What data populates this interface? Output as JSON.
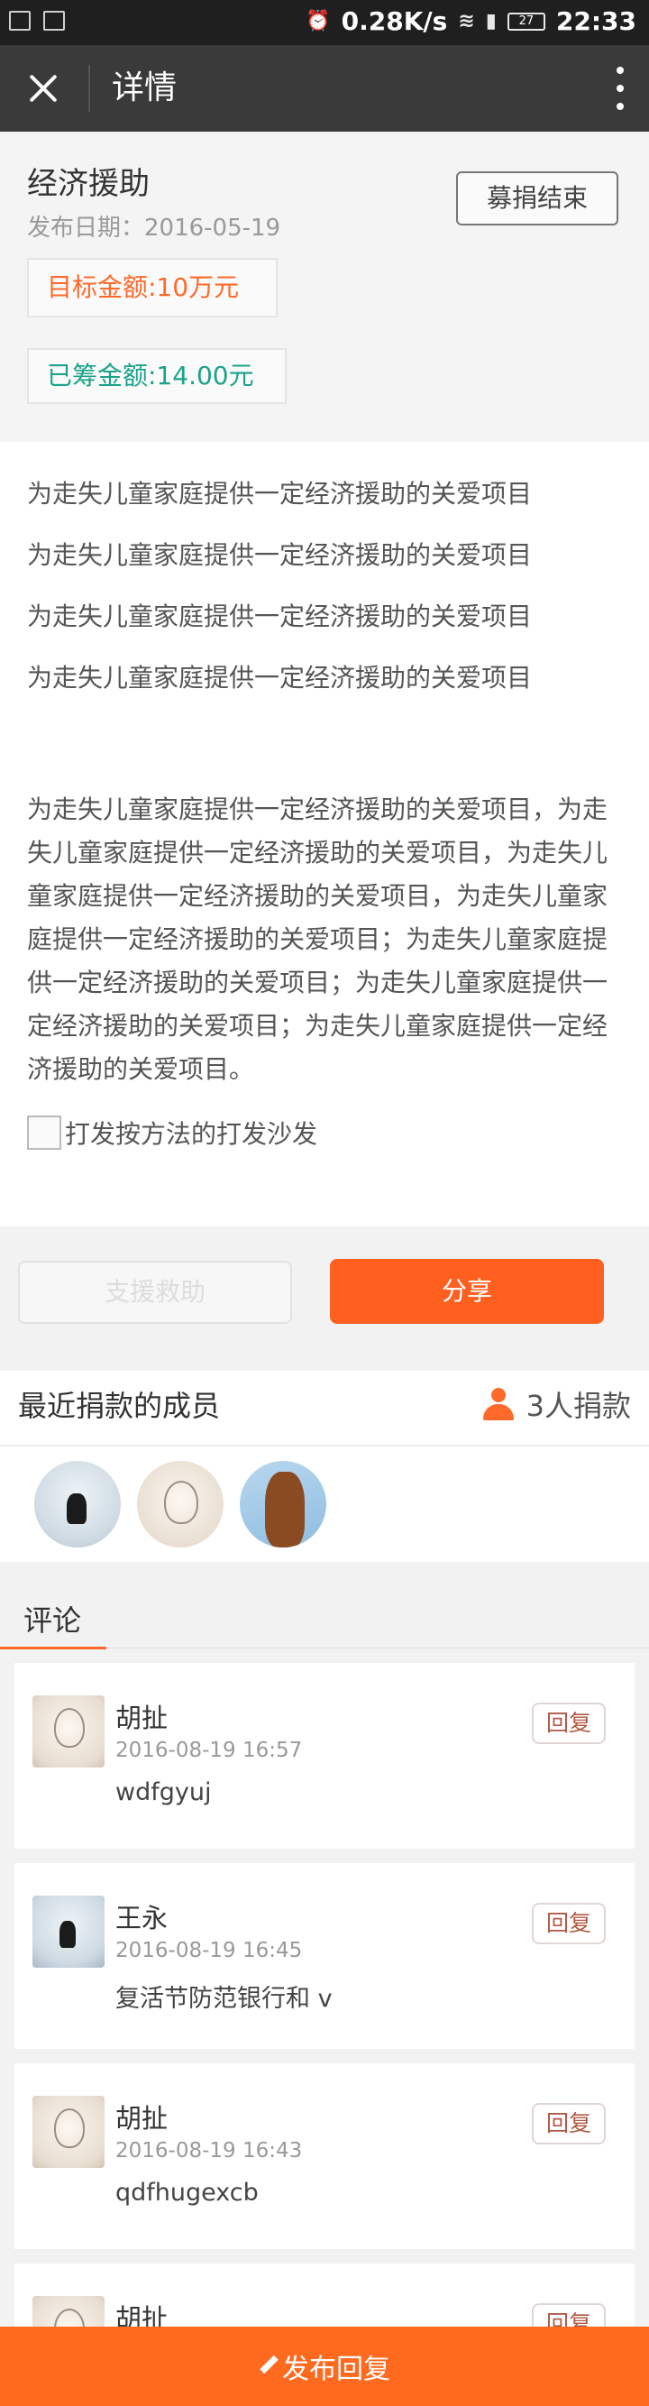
{
  "status_bar": {
    "net_speed": "0.28K/s",
    "network": "4G",
    "battery": "27",
    "time": "22:33"
  },
  "app_bar": {
    "title": "详情"
  },
  "project": {
    "title": "经济援助",
    "publish_date": "发布日期：2016-05-19",
    "status_button": "募捐结束",
    "target_amount": "目标金额:10万元",
    "raised_amount": "已筹金额:14.00元"
  },
  "description": {
    "lines": [
      "为走失儿童家庭提供一定经济援助的关爱项目",
      "为走失儿童家庭提供一定经济援助的关爱项目",
      "为走失儿童家庭提供一定经济援助的关爱项目",
      "为走失儿童家庭提供一定经济援助的关爱项目"
    ],
    "paragraph": "为走失儿童家庭提供一定经济援助的关爱项目，为走失儿童家庭提供一定经济援助的关爱项目，为走失儿童家庭提供一定经济援助的关爱项目，为走失儿童家庭提供一定经济援助的关爱项目；为走失儿童家庭提供一定经济援助的关爱项目；为走失儿童家庭提供一定经济援助的关爱项目；为走失儿童家庭提供一定经济援助的关爱项目。",
    "image_alt": "打发按方法的打发沙发"
  },
  "actions": {
    "support_label": "支援救助",
    "share_label": "分享"
  },
  "donors": {
    "title": "最近捐款的成员",
    "count_label": "3人捐款"
  },
  "comments": {
    "tab_label": "评论",
    "reply_label": "回复",
    "items": [
      {
        "name": "胡扯",
        "time": "2016-08-19 16:57",
        "text": "wdfgyuj"
      },
      {
        "name": "王永",
        "time": "2016-08-19 16:45",
        "text": "复活节防范银行和 v"
      },
      {
        "name": "胡扯",
        "time": "2016-08-19 16:43",
        "text": "qdfhugexcb"
      },
      {
        "name": "胡扯",
        "time": "",
        "text": ""
      }
    ]
  },
  "bottom_bar": {
    "label": "发布回复"
  },
  "colors": {
    "accent": "#ff6a1f",
    "raised": "#1aa38a",
    "appbar": "#3a3a3a"
  }
}
